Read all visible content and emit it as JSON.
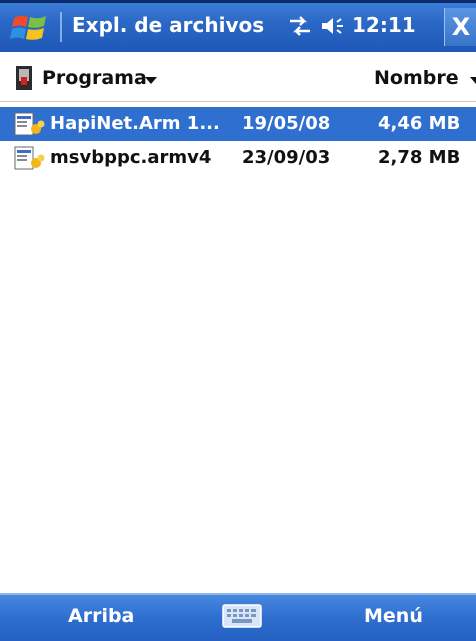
{
  "titlebar": {
    "title": "Expl. de archivos",
    "clock": "12:11",
    "close_label": "X",
    "icons": [
      "windows-start-icon",
      "connectivity-icon",
      "volume-icon"
    ]
  },
  "header": {
    "folder_label": "Programa",
    "sort_label": "Nombre"
  },
  "files": [
    {
      "name": "HapiNet.Arm 1...",
      "date": "19/05/08",
      "size": "4,46 MB",
      "selected": true
    },
    {
      "name": "msvbppc.armv4",
      "date": "23/09/03",
      "size": "2,78 MB",
      "selected": false
    }
  ],
  "menubar": {
    "left_softkey": "Arriba",
    "right_softkey": "Menú",
    "center_icon": "keyboard-icon"
  },
  "colors": {
    "titlebar": "#2a67c6",
    "selection": "#2f6fd0",
    "menubar": "#2f6fd0"
  }
}
